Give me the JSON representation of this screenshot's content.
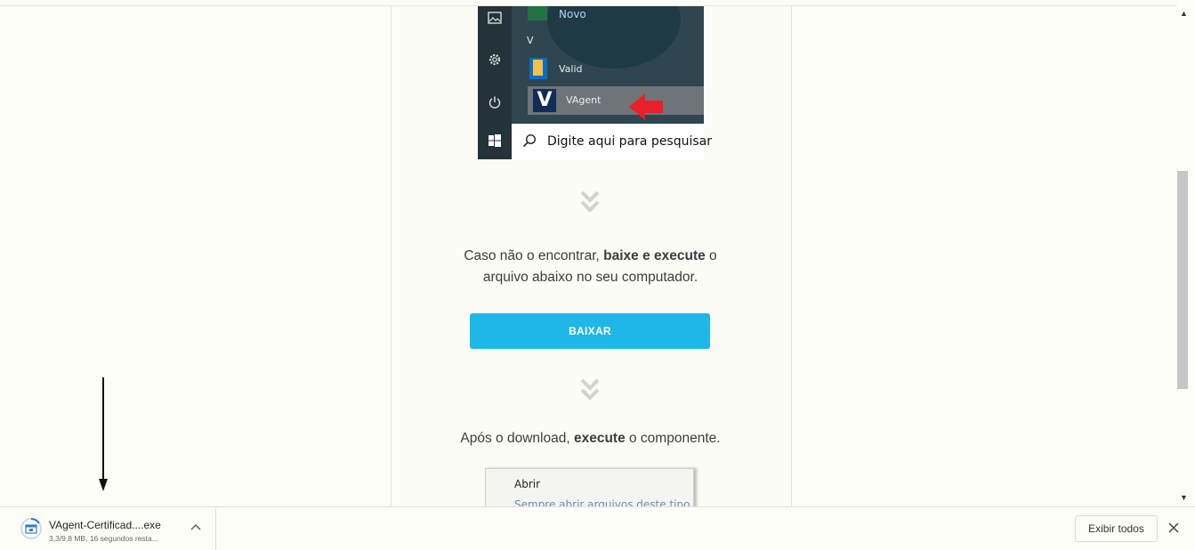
{
  "start_menu": {
    "tile_novo": "Novo",
    "letter_v": "V",
    "item_valid": "Valid",
    "item_vagent": "VAgent",
    "vagent_logo_letter": "V",
    "search_placeholder": "Digite aqui para pesquisar"
  },
  "instructions": {
    "line1_prefix": "Caso não o encontrar, ",
    "line1_bold": "baixe e execute",
    "line1_suffix": " o",
    "line2": "arquivo abaixo no seu computador.",
    "download_button": "BAIXAR",
    "after_prefix": "Após o download, ",
    "after_bold": "execute",
    "after_suffix": " o componente."
  },
  "context_menu": {
    "items": [
      "Abrir",
      "Sempre abrir arquivos deste tipo"
    ]
  },
  "download_bar": {
    "file_name": "VAgent-Certificad....exe",
    "status": "3,3/9,8 MB, 16 segundos resta...",
    "show_all": "Exibir todos"
  },
  "colors": {
    "accent": "#1fb6e8",
    "annotation_red": "#e8202a",
    "start_menu_bg": "#2f4650"
  },
  "icons": [
    "image-icon",
    "gear-icon",
    "power-icon",
    "windows-icon",
    "search-icon",
    "chevron-double-down-icon",
    "file-icon",
    "chevron-up-icon",
    "close-icon"
  ]
}
